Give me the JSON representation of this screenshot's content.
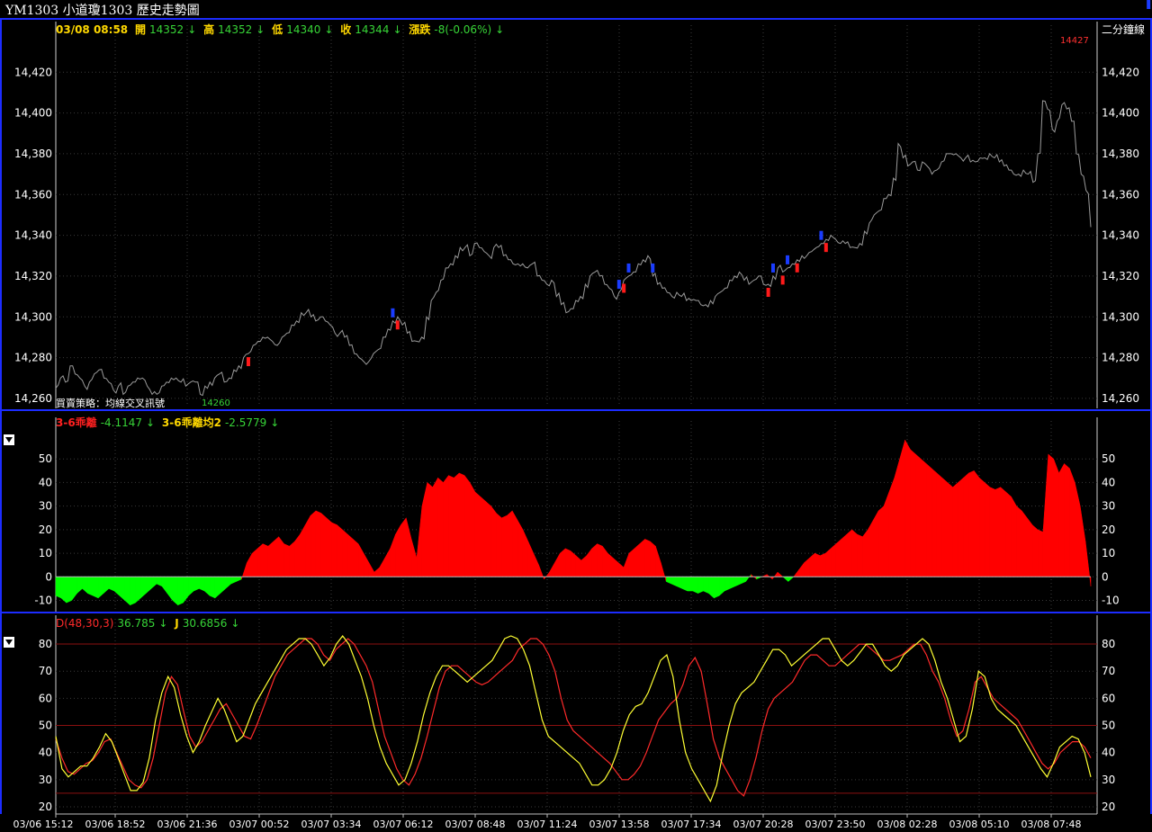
{
  "window_title": "YM1303 小道瓊1303  歷史走勢圖",
  "period_label": "二分鐘線",
  "price_header": {
    "datetime": "03/08 08:58",
    "open_label": "開",
    "open": "14352",
    "high_label": "高",
    "high": "14352",
    "low_label": "低",
    "low": "14340",
    "close_label": "收",
    "close": "14344",
    "change_label": "漲跌",
    "change": "-8(-0.06%)"
  },
  "strategy_label": "買賣策略：均線交叉訊號",
  "low_marker": "14260",
  "high_marker": "14427",
  "osc_header": {
    "name1": "3-6乖離",
    "value1": "-4.1147",
    "name2": "3-6乖離均2",
    "value2": "-2.5779"
  },
  "kd_header": {
    "name1": "D(48,30,3)",
    "value1": "36.785",
    "name2": "J",
    "value2": "30.6856"
  },
  "colors": {
    "price": "#9a9a9a",
    "up": "#ff0000",
    "down": "#00ff00",
    "d_line": "#ff2a2a",
    "j_line": "#ffff33",
    "buy": "#ff1a1a",
    "sell": "#1a3cff"
  },
  "chart_data": [
    {
      "type": "line",
      "name": "price",
      "x_labels": [
        "03/06 15:12",
        "03/06 18:52",
        "03/06 21:36",
        "03/07 00:52",
        "03/07 03:34",
        "03/07 06:12",
        "03/07 08:48",
        "03/07 11:24",
        "03/07 13:58",
        "03/07 17:34",
        "03/07 20:28",
        "03/07 23:50",
        "03/08 02:28",
        "03/08 05:10",
        "03/08 07:48"
      ],
      "y_ticks": [
        14260,
        14280,
        14300,
        14320,
        14340,
        14360,
        14380,
        14400,
        14420
      ],
      "y_tick_labels": [
        "14,260",
        "14,280",
        "14,300",
        "14,320",
        "14,340",
        "14,360",
        "14,380",
        "14,400",
        "14,420"
      ],
      "ylim": [
        14256,
        14436
      ],
      "series": [
        {
          "values": [
            14265,
            14270,
            14268,
            14276,
            14272,
            14270,
            14266,
            14268,
            14272,
            14274,
            14270,
            14268,
            14264,
            14266,
            14262,
            14266,
            14268,
            14270,
            14270,
            14266,
            14262,
            14262,
            14266,
            14268,
            14270,
            14270,
            14268,
            14266,
            14268,
            14268,
            14262,
            14266,
            14268,
            14270,
            14272,
            14268,
            14270,
            14274,
            14276,
            14280,
            14282,
            14286,
            14288,
            14290,
            14290,
            14288,
            14286,
            14290,
            14292,
            14296,
            14298,
            14302,
            14302,
            14300,
            14298,
            14300,
            14298,
            14296,
            14292,
            14292,
            14290,
            14286,
            14282,
            14280,
            14278,
            14278,
            14282,
            14284,
            14290,
            14294,
            14298,
            14300,
            14296,
            14292,
            14288,
            14288,
            14290,
            14300,
            14308,
            14312,
            14318,
            14324,
            14326,
            14330,
            14334,
            14334,
            14330,
            14336,
            14334,
            14332,
            14330,
            14334,
            14334,
            14330,
            14328,
            14326,
            14326,
            14326,
            14324,
            14326,
            14320,
            14318,
            14316,
            14318,
            14310,
            14306,
            14302,
            14304,
            14308,
            14310,
            14316,
            14320,
            14322,
            14320,
            14316,
            14314,
            14310,
            14312,
            14318,
            14320,
            14322,
            14326,
            14328,
            14330,
            14320,
            14316,
            14314,
            14312,
            14310,
            14312,
            14310,
            14308,
            14308,
            14308,
            14306,
            14306,
            14308,
            14310,
            14312,
            14314,
            14318,
            14320,
            14322,
            14318,
            14316,
            14318,
            14320,
            14316,
            14316,
            14320,
            14324,
            14322,
            14324,
            14326,
            14328,
            14330,
            14330,
            14332,
            14334,
            14336,
            14338,
            14340,
            14338,
            14336,
            14336,
            14334,
            14334,
            14336,
            14342,
            14346,
            14350,
            14352,
            14358,
            14360,
            14368,
            14385,
            14378,
            14374,
            14376,
            14372,
            14376,
            14374,
            14370,
            14372,
            14376,
            14380,
            14380,
            14380,
            14378,
            14378,
            14376,
            14376,
            14378,
            14378,
            14380,
            14378,
            14376,
            14374,
            14372,
            14370,
            14370,
            14372,
            14370,
            14366,
            14380,
            14406,
            14402,
            14392,
            14396,
            14404,
            14402,
            14396,
            14380,
            14370,
            14362,
            14344
          ]
        }
      ],
      "signals": [
        {
          "i": 40,
          "type": "buy"
        },
        {
          "i": 70,
          "type": "sell"
        },
        {
          "i": 71,
          "type": "buy"
        },
        {
          "i": 117,
          "type": "sell"
        },
        {
          "i": 118,
          "type": "buy"
        },
        {
          "i": 119,
          "type": "sell"
        },
        {
          "i": 124,
          "type": "sell"
        },
        {
          "i": 148,
          "type": "buy"
        },
        {
          "i": 149,
          "type": "sell"
        },
        {
          "i": 151,
          "type": "buy"
        },
        {
          "i": 152,
          "type": "sell"
        },
        {
          "i": 154,
          "type": "buy"
        },
        {
          "i": 159,
          "type": "sell"
        },
        {
          "i": 160,
          "type": "buy"
        },
        {
          "i": 227,
          "type": "sell"
        }
      ]
    },
    {
      "type": "area",
      "name": "3-6乖離",
      "y_ticks": [
        -10,
        0,
        10,
        20,
        30,
        40,
        50
      ],
      "ylim": [
        -14,
        60
      ],
      "values": [
        -8,
        -9,
        -11,
        -10,
        -7,
        -5,
        -7,
        -8,
        -9,
        -7,
        -5,
        -6,
        -8,
        -10,
        -12,
        -11,
        -9,
        -7,
        -5,
        -3,
        -4,
        -7,
        -10,
        -12,
        -11,
        -8,
        -6,
        -5,
        -6,
        -8,
        -9,
        -7,
        -5,
        -3,
        -2,
        -1,
        6,
        10,
        12,
        14,
        13,
        15,
        17,
        14,
        13,
        15,
        18,
        22,
        26,
        28,
        27,
        25,
        23,
        22,
        20,
        18,
        16,
        14,
        10,
        6,
        2,
        4,
        8,
        12,
        18,
        22,
        25,
        16,
        8,
        30,
        40,
        38,
        42,
        40,
        43,
        42,
        44,
        43,
        40,
        36,
        34,
        32,
        30,
        27,
        25,
        26,
        28,
        24,
        20,
        15,
        10,
        5,
        -1,
        2,
        6,
        10,
        12,
        11,
        9,
        7,
        9,
        12,
        14,
        13,
        10,
        8,
        6,
        4,
        10,
        12,
        14,
        16,
        15,
        13,
        6,
        -2,
        -3,
        -4,
        -5,
        -6,
        -6,
        -7,
        -6,
        -7,
        -9,
        -8,
        -6,
        -5,
        -4,
        -3,
        -2,
        1,
        -1,
        0,
        1,
        -1,
        2,
        0,
        -2,
        0,
        3,
        6,
        8,
        10,
        9,
        10,
        12,
        14,
        16,
        18,
        20,
        18,
        17,
        20,
        24,
        28,
        30,
        36,
        42,
        50,
        58,
        54,
        52,
        50,
        48,
        46,
        44,
        42,
        40,
        38,
        40,
        42,
        44,
        45,
        42,
        40,
        38,
        37,
        38,
        36,
        34,
        30,
        28,
        25,
        22,
        20,
        19,
        52,
        50,
        44,
        48,
        46,
        40,
        30,
        15,
        -4
      ]
    },
    {
      "type": "line",
      "name": "D/J",
      "y_ticks": [
        20,
        30,
        40,
        50,
        60,
        70,
        80
      ],
      "ylim": [
        18,
        84
      ],
      "ref_lines": [
        25,
        50,
        80
      ],
      "series": [
        {
          "name": "D",
          "values": [
            45,
            38,
            33,
            32,
            34,
            36,
            37,
            40,
            44,
            45,
            40,
            35,
            30,
            28,
            27,
            30,
            38,
            50,
            62,
            68,
            65,
            55,
            46,
            42,
            44,
            48,
            52,
            56,
            58,
            54,
            50,
            46,
            45,
            50,
            56,
            62,
            68,
            72,
            76,
            78,
            80,
            82,
            82,
            80,
            76,
            74,
            78,
            80,
            82,
            80,
            76,
            72,
            66,
            56,
            46,
            40,
            34,
            30,
            28,
            32,
            38,
            46,
            55,
            64,
            70,
            72,
            72,
            70,
            68,
            66,
            65,
            66,
            68,
            70,
            72,
            74,
            78,
            80,
            82,
            82,
            80,
            76,
            70,
            60,
            52,
            48,
            46,
            44,
            42,
            40,
            38,
            36,
            33,
            30,
            30,
            32,
            35,
            40,
            46,
            52,
            55,
            58,
            60,
            65,
            72,
            75,
            70,
            58,
            45,
            38,
            34,
            30,
            26,
            24,
            30,
            38,
            48,
            56,
            60,
            62,
            64,
            66,
            70,
            74,
            76,
            76,
            74,
            72,
            72,
            74,
            76,
            78,
            80,
            80,
            78,
            76,
            74,
            74,
            75,
            76,
            78,
            80,
            80,
            76,
            70,
            66,
            60,
            52,
            46,
            48,
            56,
            66,
            68,
            64,
            60,
            58,
            56,
            54,
            52,
            48,
            44,
            40,
            36,
            34,
            36,
            40,
            42,
            44,
            44,
            42,
            38
          ]
        },
        {
          "name": "J",
          "values": [
            46,
            34,
            31,
            33,
            35,
            35,
            38,
            42,
            47,
            44,
            38,
            32,
            26,
            26,
            29,
            38,
            52,
            62,
            68,
            64,
            54,
            46,
            40,
            44,
            50,
            55,
            60,
            56,
            50,
            44,
            46,
            52,
            58,
            62,
            66,
            70,
            74,
            78,
            80,
            82,
            82,
            80,
            76,
            72,
            75,
            80,
            83,
            80,
            74,
            68,
            60,
            50,
            42,
            36,
            32,
            28,
            30,
            36,
            44,
            54,
            62,
            68,
            72,
            72,
            70,
            68,
            66,
            68,
            70,
            72,
            74,
            78,
            82,
            83,
            82,
            78,
            72,
            62,
            52,
            46,
            44,
            42,
            40,
            38,
            36,
            32,
            28,
            28,
            30,
            34,
            40,
            48,
            54,
            57,
            58,
            62,
            68,
            74,
            76,
            68,
            52,
            40,
            34,
            30,
            26,
            22,
            28,
            40,
            50,
            58,
            62,
            64,
            66,
            70,
            74,
            78,
            78,
            76,
            72,
            74,
            76,
            78,
            80,
            82,
            82,
            78,
            74,
            72,
            74,
            77,
            80,
            80,
            76,
            72,
            70,
            72,
            76,
            78,
            80,
            82,
            80,
            74,
            66,
            60,
            52,
            44,
            46,
            56,
            70,
            68,
            60,
            56,
            54,
            52,
            50,
            46,
            42,
            38,
            34,
            31,
            36,
            42,
            44,
            46,
            45,
            40,
            31
          ]
        }
      ]
    }
  ]
}
